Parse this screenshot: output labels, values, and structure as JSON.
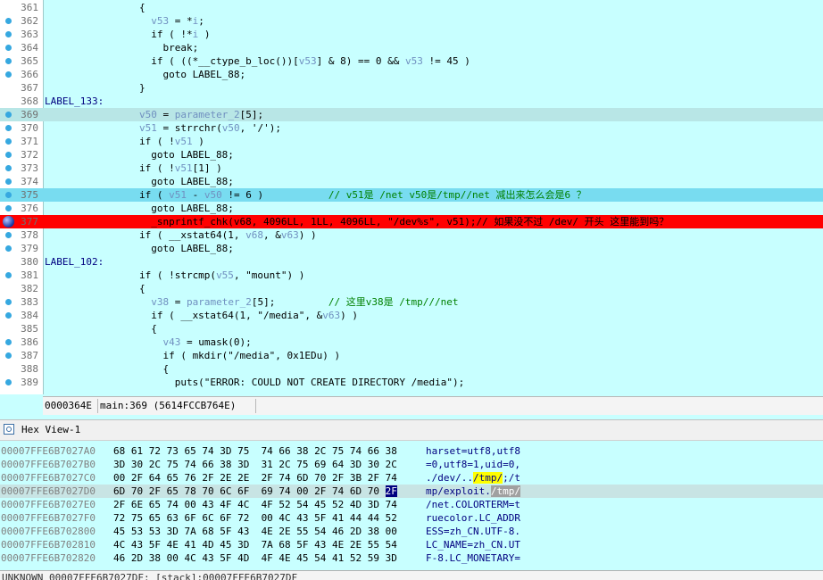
{
  "code_lines": [
    {
      "num": "361",
      "segs": [
        {
          "t": "                {",
          "c": ""
        }
      ]
    },
    {
      "num": "362",
      "segs": [
        {
          "t": "                  ",
          "c": ""
        },
        {
          "t": "v53",
          "c": "v"
        },
        {
          "t": " = *",
          "c": ""
        },
        {
          "t": "i",
          "c": "v"
        },
        {
          "t": ";",
          "c": ""
        }
      ]
    },
    {
      "num": "363",
      "segs": [
        {
          "t": "                  if ( !*",
          "c": ""
        },
        {
          "t": "i",
          "c": "v"
        },
        {
          "t": " )",
          "c": ""
        }
      ]
    },
    {
      "num": "364",
      "segs": [
        {
          "t": "                    break;",
          "c": ""
        }
      ]
    },
    {
      "num": "365",
      "segs": [
        {
          "t": "                  if ( ((*__ctype_b_loc())[",
          "c": ""
        },
        {
          "t": "v53",
          "c": "v"
        },
        {
          "t": "] & 8) == 0 && ",
          "c": ""
        },
        {
          "t": "v53",
          "c": "v"
        },
        {
          "t": " != 45 )",
          "c": ""
        }
      ]
    },
    {
      "num": "366",
      "segs": [
        {
          "t": "                    goto LABEL_88;",
          "c": ""
        }
      ]
    },
    {
      "num": "367",
      "segs": [
        {
          "t": "                }",
          "c": ""
        }
      ]
    },
    {
      "num": "368",
      "segs": [
        {
          "t": "LABEL_133:",
          "c": "lbl"
        }
      ]
    },
    {
      "num": "369",
      "segs": [
        {
          "t": "                ",
          "c": ""
        },
        {
          "t": "v50",
          "c": "v"
        },
        {
          "t": " = ",
          "c": ""
        },
        {
          "t": "parameter_2",
          "c": "v"
        },
        {
          "t": "[5];",
          "c": ""
        }
      ]
    },
    {
      "num": "370",
      "segs": [
        {
          "t": "                ",
          "c": ""
        },
        {
          "t": "v51",
          "c": "v"
        },
        {
          "t": " = strrchr(",
          "c": ""
        },
        {
          "t": "v50",
          "c": "v"
        },
        {
          "t": ", '/');",
          "c": ""
        }
      ]
    },
    {
      "num": "371",
      "segs": [
        {
          "t": "                if ( !",
          "c": ""
        },
        {
          "t": "v51",
          "c": "v"
        },
        {
          "t": " )",
          "c": ""
        }
      ]
    },
    {
      "num": "372",
      "segs": [
        {
          "t": "                  goto LABEL_88;",
          "c": ""
        }
      ]
    },
    {
      "num": "373",
      "segs": [
        {
          "t": "                if ( !",
          "c": ""
        },
        {
          "t": "v51",
          "c": "v"
        },
        {
          "t": "[1] )",
          "c": ""
        }
      ]
    },
    {
      "num": "374",
      "segs": [
        {
          "t": "                  goto LABEL_88;",
          "c": ""
        }
      ]
    },
    {
      "num": "375",
      "segs": [
        {
          "t": "                if ( ",
          "c": ""
        },
        {
          "t": "v51",
          "c": "v"
        },
        {
          "t": " - ",
          "c": ""
        },
        {
          "t": "v50",
          "c": "v"
        },
        {
          "t": " != 6 )           ",
          "c": ""
        },
        {
          "t": "// v51是 /net v50是/tmp//net 减出来怎么会是6 ？",
          "c": "c"
        }
      ]
    },
    {
      "num": "376",
      "segs": [
        {
          "t": "                  goto LABEL_88;",
          "c": ""
        }
      ]
    },
    {
      "num": "377",
      "segs": [
        {
          "t": "                  _snprintf_chk(v68, 4096LL, 1LL, 4096LL, \"/dev%s\", v51);// 如果没不过 /dev/ 开头 这里能到吗？",
          "c": ""
        }
      ]
    },
    {
      "num": "378",
      "segs": [
        {
          "t": "                if ( __xstat64(1, ",
          "c": ""
        },
        {
          "t": "v68",
          "c": "v"
        },
        {
          "t": ", &",
          "c": ""
        },
        {
          "t": "v63",
          "c": "v"
        },
        {
          "t": ") )",
          "c": ""
        }
      ]
    },
    {
      "num": "379",
      "segs": [
        {
          "t": "                  goto LABEL_88;",
          "c": ""
        }
      ]
    },
    {
      "num": "380",
      "segs": [
        {
          "t": "LABEL_102:",
          "c": "lbl"
        }
      ]
    },
    {
      "num": "381",
      "segs": [
        {
          "t": "                if ( !strcmp(",
          "c": ""
        },
        {
          "t": "v55",
          "c": "v"
        },
        {
          "t": ", \"mount\") )",
          "c": ""
        }
      ]
    },
    {
      "num": "382",
      "segs": [
        {
          "t": "                {",
          "c": ""
        }
      ]
    },
    {
      "num": "383",
      "segs": [
        {
          "t": "                  ",
          "c": ""
        },
        {
          "t": "v38",
          "c": "v"
        },
        {
          "t": " = ",
          "c": ""
        },
        {
          "t": "parameter_2",
          "c": "v"
        },
        {
          "t": "[5];         ",
          "c": ""
        },
        {
          "t": "// 这里v38是 /tmp///net",
          "c": "c"
        }
      ]
    },
    {
      "num": "384",
      "segs": [
        {
          "t": "                  if ( __xstat64(1, \"/media\", &",
          "c": ""
        },
        {
          "t": "v63",
          "c": "v"
        },
        {
          "t": ") )",
          "c": ""
        }
      ]
    },
    {
      "num": "385",
      "segs": [
        {
          "t": "                  {",
          "c": ""
        }
      ]
    },
    {
      "num": "386",
      "segs": [
        {
          "t": "                    ",
          "c": ""
        },
        {
          "t": "v43",
          "c": "v"
        },
        {
          "t": " = umask(0);",
          "c": ""
        }
      ]
    },
    {
      "num": "387",
      "segs": [
        {
          "t": "                    if ( mkdir(\"/media\", 0x1EDu) )",
          "c": ""
        }
      ]
    },
    {
      "num": "388",
      "segs": [
        {
          "t": "                    {",
          "c": ""
        }
      ]
    },
    {
      "num": "389",
      "segs": [
        {
          "t": "                      puts(\"ERROR: COULD NOT CREATE DIRECTORY /media\");",
          "c": ""
        }
      ]
    }
  ],
  "status": {
    "offset": "0000364E",
    "location": "main:369 (5614FCCB764E)"
  },
  "hex_view": {
    "title": "Hex View-1",
    "rows": [
      {
        "addr": "00007FFE6B7027A0",
        "bytes": "68 61 72 73 65 74 3D 75  74 66 38 2C 75 74 66 38",
        "ascii": "harset=utf8,utf8"
      },
      {
        "addr": "00007FFE6B7027B0",
        "bytes": "3D 30 2C 75 74 66 38 3D  31 2C 75 69 64 3D 30 2C",
        "ascii": "=0,utf8=1,uid=0,"
      },
      {
        "addr": "00007FFE6B7027C0",
        "bytes": "00 2F 64 65 76 2F 2E 2E  2F 74 6D 70 2F 3B 2F 74",
        "ascii_segs": [
          {
            "t": "./dev/..",
            "c": ""
          },
          {
            "t": "/tmp/",
            "c": "yel"
          },
          {
            "t": ";/t",
            "c": ""
          }
        ]
      },
      {
        "addr": "00007FFE6B7027D0",
        "bytes_segs": [
          {
            "t": "6D 70 2F 65 78 70 6C 6F  69 74 00 2F 74 6D 70 ",
            "c": ""
          },
          {
            "t": "2F",
            "c": "selb"
          }
        ],
        "ascii_segs": [
          {
            "t": "mp/exploit.",
            "c": ""
          },
          {
            "t": "/tmp/",
            "c": "gry"
          }
        ]
      },
      {
        "addr": "00007FFE6B7027E0",
        "bytes": "2F 6E 65 74 00 43 4F 4C  4F 52 54 45 52 4D 3D 74",
        "ascii": "/net.COLORTERM=t"
      },
      {
        "addr": "00007FFE6B7027F0",
        "bytes": "72 75 65 63 6F 6C 6F 72  00 4C 43 5F 41 44 44 52",
        "ascii": "ruecolor.LC_ADDR"
      },
      {
        "addr": "00007FFE6B702800",
        "bytes": "45 53 53 3D 7A 68 5F 43  4E 2E 55 54 46 2D 38 00",
        "ascii": "ESS=zh_CN.UTF-8."
      },
      {
        "addr": "00007FFE6B702810",
        "bytes": "4C 43 5F 4E 41 4D 45 3D  7A 68 5F 43 4E 2E 55 54",
        "ascii": "LC_NAME=zh_CN.UT"
      },
      {
        "addr": "00007FFE6B702820",
        "bytes": "46 2D 38 00 4C 43 5F 4D  4F 4E 45 54 41 52 59 3D",
        "ascii": "F-8.LC_MONETARY="
      }
    ],
    "status": "UNKNOWN 00007FFE6B7027DF: [stack]:00007FFE6B7027DF"
  }
}
